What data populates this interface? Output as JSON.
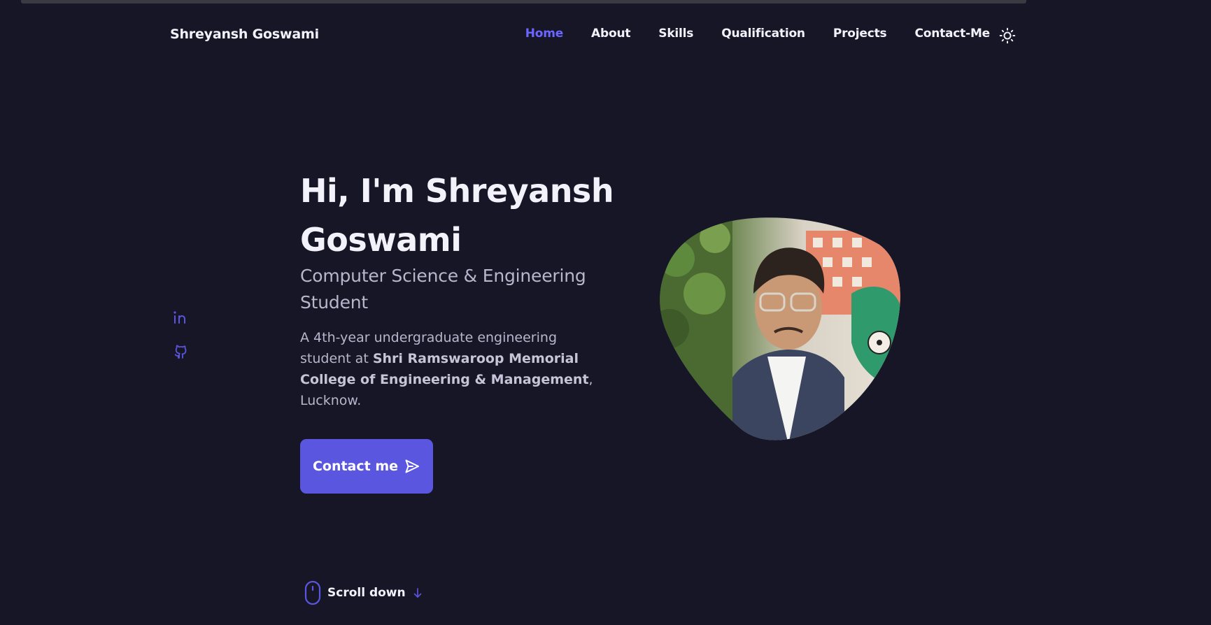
{
  "header": {
    "brand": "Shreyansh Goswami",
    "nav": [
      {
        "label": "Home",
        "active": true
      },
      {
        "label": "About"
      },
      {
        "label": "Skills"
      },
      {
        "label": "Qualification"
      },
      {
        "label": "Projects"
      },
      {
        "label": "Contact-Me"
      }
    ],
    "theme_icon": "sun-icon"
  },
  "social": [
    {
      "icon": "linkedin-icon"
    },
    {
      "icon": "github-icon"
    }
  ],
  "hero": {
    "title": "Hi, I'm Shreyansh Goswami",
    "subtitle": "Computer Science & Engineering Student",
    "desc_prefix": "A 4th-year undergraduate engineering student at ",
    "desc_college": "Shri Ramswaroop Memorial College of Engineering & Management",
    "desc_suffix": ", Lucknow.",
    "button_label": "Contact me",
    "button_icon": "send-icon"
  },
  "scroll": {
    "label": "Scroll down",
    "icon": "mouse-icon",
    "arrow_icon": "arrow-down-icon"
  },
  "colors": {
    "background": "#171626",
    "accent": "#5b56e0",
    "active_nav": "#6b66ff",
    "text": "#f3f2fa",
    "muted_text": "#b9b6cc"
  }
}
